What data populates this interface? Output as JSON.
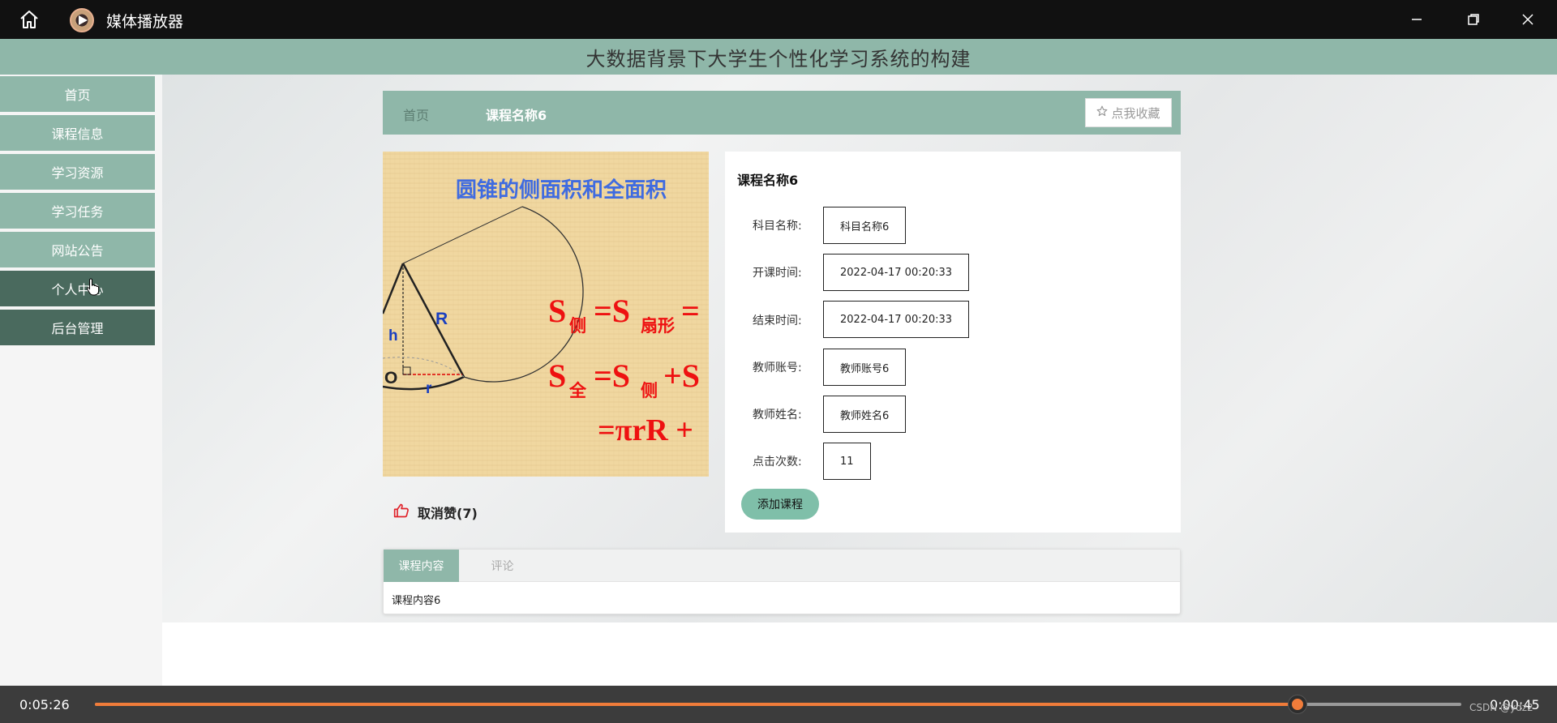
{
  "player": {
    "title": "媒体播放器",
    "current_time": "0:05:26",
    "remaining_time": "0:00:45",
    "progress_percent": 88,
    "watermark": "CSDN @ydz2"
  },
  "site": {
    "title": "大数据背景下大学生个性化学习系统的构建"
  },
  "sidebar": {
    "items": [
      {
        "label": "首页"
      },
      {
        "label": "课程信息"
      },
      {
        "label": "学习资源"
      },
      {
        "label": "学习任务"
      },
      {
        "label": "网站公告"
      },
      {
        "label": "个人中心"
      },
      {
        "label": "后台管理"
      }
    ]
  },
  "breadcrumb": {
    "home": "首页",
    "current": "课程名称6",
    "favorite_button": "点我收藏"
  },
  "image": {
    "title_text": "圆锥的侧面积和全面积",
    "formula_1a": "S",
    "formula_1b": "侧",
    "formula_1c": "=S",
    "formula_1d": "扇形",
    "formula_1e": "=",
    "formula_2a": "S",
    "formula_2b": "全",
    "formula_2c": "=S",
    "formula_2d": "侧",
    "formula_2e": "+S",
    "formula_3": "=πrR +",
    "label_h": "h",
    "label_R": "R",
    "label_O": "O",
    "label_r": "r"
  },
  "like": {
    "label": "取消赞(7)"
  },
  "course": {
    "name": "课程名称6",
    "fields": [
      {
        "label": "科目名称:",
        "value": "科目名称6"
      },
      {
        "label": "开课时间:",
        "value": "2022-04-17 00:20:33"
      },
      {
        "label": "结束时间:",
        "value": "2022-04-17 00:20:33"
      },
      {
        "label": "教师账号:",
        "value": "教师账号6"
      },
      {
        "label": "教师姓名:",
        "value": "教师姓名6"
      },
      {
        "label": "点击次数:",
        "value": "11"
      }
    ],
    "add_button": "添加课程"
  },
  "tabs": {
    "items": [
      {
        "label": "课程内容"
      },
      {
        "label": "评论"
      }
    ],
    "content": "课程内容6"
  },
  "colors": {
    "accent": "#8fb7a9",
    "accent_dark": "#4a6a5e",
    "progress": "#f07c3a"
  }
}
